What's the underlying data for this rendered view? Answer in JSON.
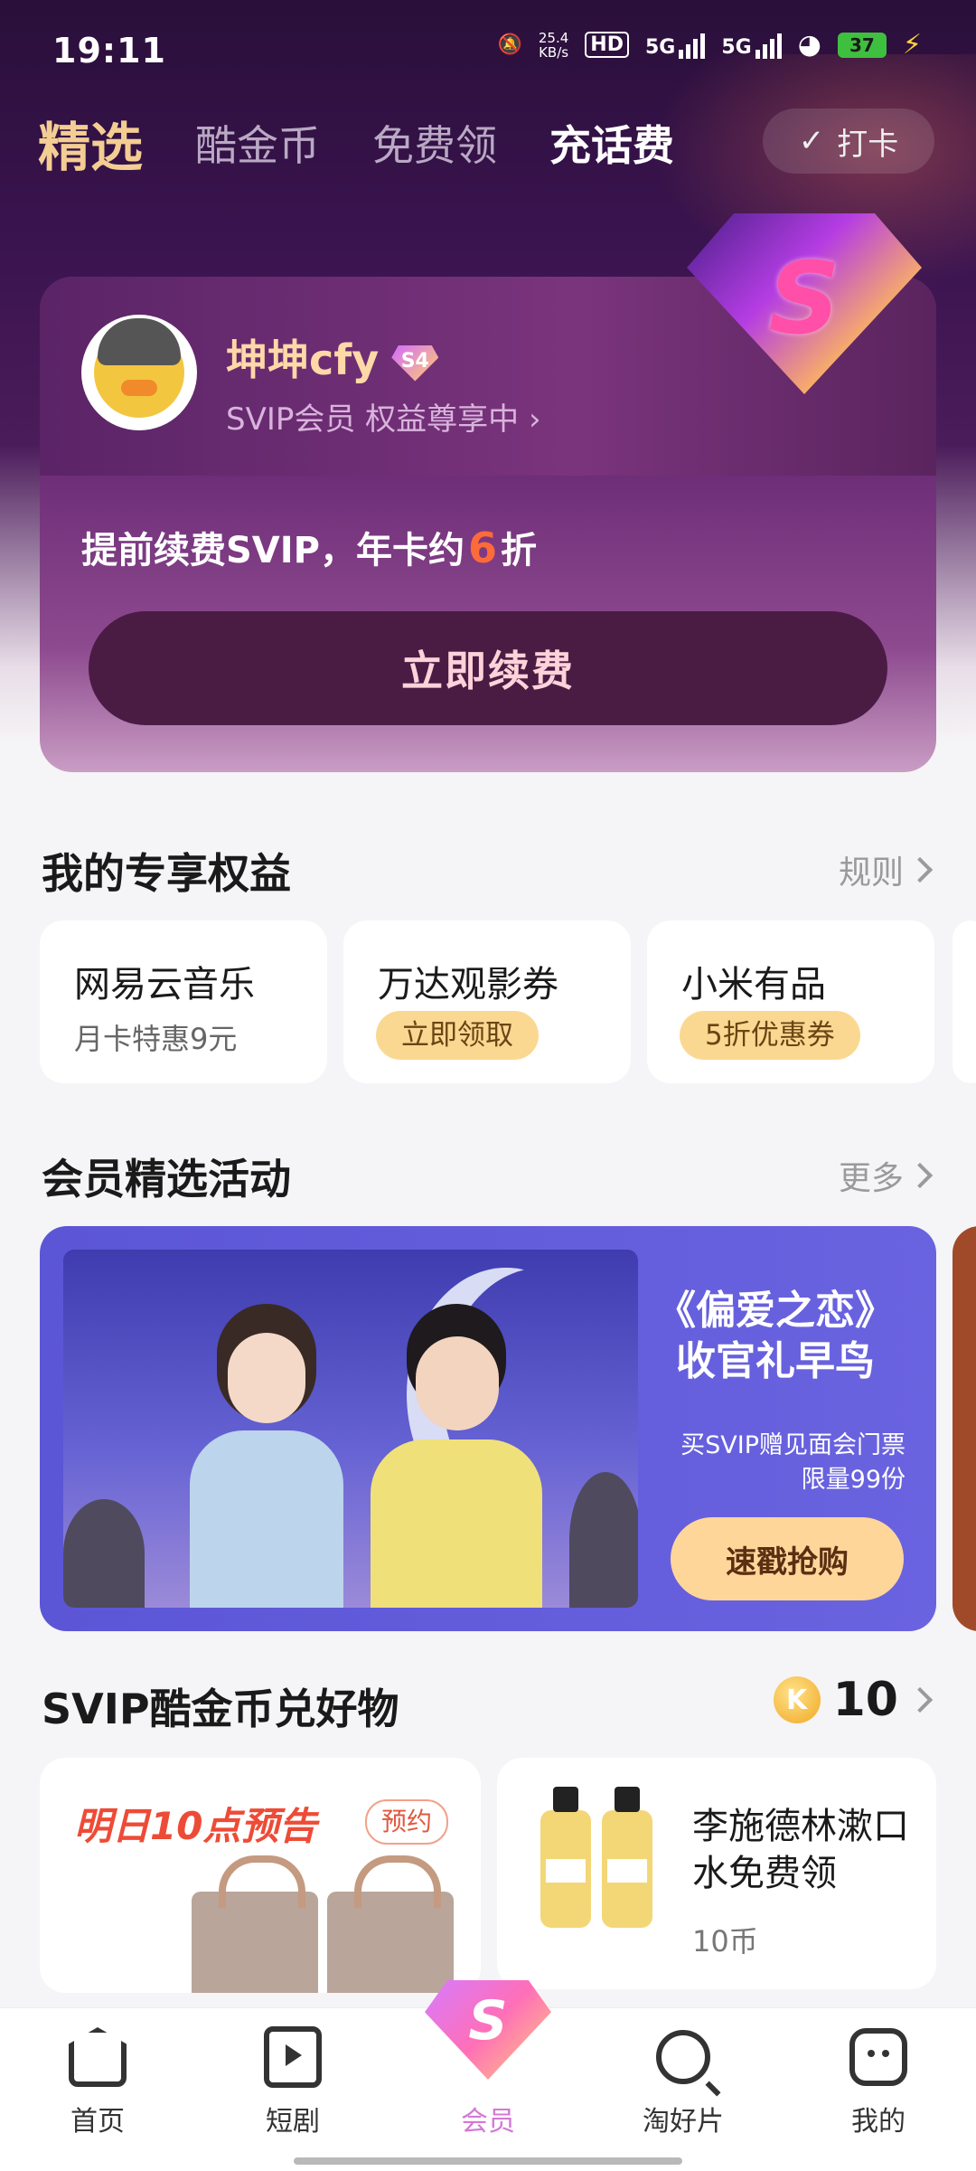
{
  "status_bar": {
    "time": "19:11",
    "speed_value": "25.4",
    "speed_unit": "KB/s",
    "battery": "37",
    "hd": "HD",
    "net1": "5G",
    "net2": "5G"
  },
  "top_tabs": [
    {
      "label": "精选"
    },
    {
      "label": "酷金币"
    },
    {
      "label": "免费领"
    },
    {
      "label": "充话费"
    }
  ],
  "checkin_label": "打卡",
  "member": {
    "username": "坤坤cfy",
    "level": "S4",
    "tag": "SVIP会员 权益尊享中",
    "promo_prefix": "提前续费SVIP，年卡约",
    "promo_highlight": "6",
    "promo_suffix": "折",
    "renew_button": "立即续费",
    "gem_letter": "S"
  },
  "benefits_section": {
    "title": "我的专享权益",
    "link": "规则",
    "items": [
      {
        "title": "网易云音乐",
        "subtitle": "月卡特惠9元"
      },
      {
        "title": "万达观影券",
        "pill": "立即领取"
      },
      {
        "title": "小米有品",
        "pill": "5折优惠券"
      }
    ]
  },
  "activity_section": {
    "title": "会员精选活动",
    "link": "更多",
    "banner": {
      "headline_1": "《偏爱之恋》",
      "headline_2": "收官礼早鸟",
      "desc_1": "买SVIP赠见面会门票",
      "desc_2": "限量99份",
      "button": "速戳抢购"
    }
  },
  "coins_section": {
    "title": "SVIP酷金币兑好物",
    "coin_symbol": "K",
    "coin_balance": "10",
    "goods": [
      {
        "preview": "明日10点预告",
        "tag": "预约"
      },
      {
        "name": "李施德林漱口水免费领",
        "price": "10币"
      }
    ]
  },
  "bottom_nav": [
    {
      "label": "首页"
    },
    {
      "label": "短剧"
    },
    {
      "label": "会员",
      "gem_letter": "S"
    },
    {
      "label": "淘好片"
    },
    {
      "label": "我的"
    }
  ],
  "colors": {
    "accent_gold": "#f4cd93",
    "card_purple": "#6e2e78",
    "active_nav": "#d478d6",
    "promo_red": "#ff6a3a"
  }
}
